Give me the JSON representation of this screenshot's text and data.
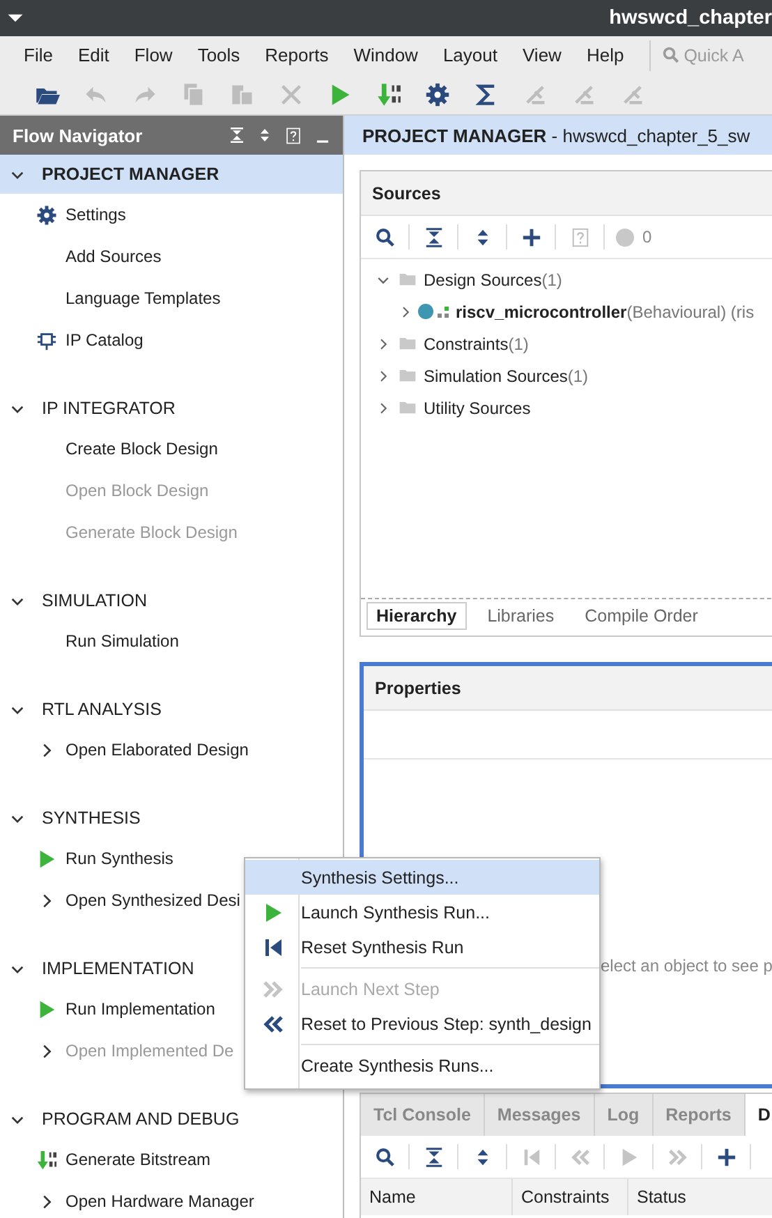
{
  "window": {
    "title": "hwswcd_chapter"
  },
  "menu": [
    "File",
    "Edit",
    "Flow",
    "Tools",
    "Reports",
    "Window",
    "Layout",
    "View",
    "Help"
  ],
  "search": {
    "placeholder": "Quick A"
  },
  "toolbar": [
    {
      "kind": "open",
      "disabled": false
    },
    {
      "kind": "undo",
      "disabled": true
    },
    {
      "kind": "redo",
      "disabled": true
    },
    {
      "kind": "copy",
      "disabled": true
    },
    {
      "kind": "paste",
      "disabled": true
    },
    {
      "kind": "delete",
      "disabled": true
    },
    {
      "kind": "run",
      "disabled": false
    },
    {
      "kind": "bitstream",
      "disabled": false
    },
    {
      "kind": "settings",
      "disabled": false
    },
    {
      "kind": "sum",
      "disabled": false
    },
    {
      "kind": "probe",
      "disabled": true
    },
    {
      "kind": "probe",
      "disabled": true
    },
    {
      "kind": "probe",
      "disabled": true
    }
  ],
  "flow_navigator": {
    "title": "Flow Navigator",
    "sections": [
      {
        "title": "PROJECT MANAGER",
        "expanded": true,
        "selected": true,
        "items": [
          {
            "label": "Settings",
            "kind": "settings",
            "disabled": false
          },
          {
            "label": "Add Sources",
            "kind": "plain",
            "disabled": false
          },
          {
            "label": "Language Templates",
            "kind": "plain",
            "disabled": false
          },
          {
            "label": "IP Catalog",
            "kind": "ip",
            "disabled": false
          }
        ]
      },
      {
        "title": "IP INTEGRATOR",
        "expanded": true,
        "selected": false,
        "items": [
          {
            "label": "Create Block Design",
            "kind": "plain",
            "disabled": false
          },
          {
            "label": "Open Block Design",
            "kind": "plain",
            "disabled": true
          },
          {
            "label": "Generate Block Design",
            "kind": "plain",
            "disabled": true
          }
        ]
      },
      {
        "title": "SIMULATION",
        "expanded": true,
        "selected": false,
        "items": [
          {
            "label": "Run Simulation",
            "kind": "plain",
            "disabled": false
          }
        ]
      },
      {
        "title": "RTL ANALYSIS",
        "expanded": true,
        "selected": false,
        "items": [
          {
            "label": "Open Elaborated Design",
            "kind": "expandable",
            "disabled": false
          }
        ]
      },
      {
        "title": "SYNTHESIS",
        "expanded": true,
        "selected": false,
        "items": [
          {
            "label": "Run Synthesis",
            "kind": "run",
            "disabled": false
          },
          {
            "label": "Open Synthesized Desi",
            "kind": "expandable",
            "disabled": false
          }
        ]
      },
      {
        "title": "IMPLEMENTATION",
        "expanded": true,
        "selected": false,
        "items": [
          {
            "label": "Run Implementation",
            "kind": "run",
            "disabled": false
          },
          {
            "label": "Open Implemented De",
            "kind": "expandable",
            "disabled": true
          }
        ]
      },
      {
        "title": "PROGRAM AND DEBUG",
        "expanded": true,
        "selected": false,
        "items": [
          {
            "label": "Generate Bitstream",
            "kind": "bitstream",
            "disabled": false
          },
          {
            "label": "Open Hardware Manager",
            "kind": "expandable",
            "disabled": false
          }
        ]
      }
    ]
  },
  "header": {
    "title": "**PROJECT MANAGER** - hwswcd_chapter_5_sw"
  },
  "sources": {
    "title": "Sources",
    "warning_count": "0",
    "toolbar": [
      {
        "kind": "search",
        "disabled": false
      },
      {
        "kind": "collapse",
        "disabled": false
      },
      {
        "kind": "expand",
        "disabled": false
      },
      {
        "kind": "add",
        "disabled": false
      },
      {
        "kind": "help",
        "disabled": true
      }
    ],
    "tree": [
      {
        "label": "Design Sources",
        "count": "(1)",
        "expanded": true,
        "children": [
          {
            "label": "riscv_microcontroller",
            "detail": "(Behavioural) (ris",
            "expanded": false
          }
        ]
      },
      {
        "label": "Constraints",
        "count": "(1)",
        "expanded": false
      },
      {
        "label": "Simulation Sources",
        "count": "(1)",
        "expanded": false
      },
      {
        "label": "Utility Sources",
        "expanded": false
      }
    ],
    "tabs": [
      {
        "label": "Hierarchy",
        "selected": true
      },
      {
        "label": "Libraries",
        "selected": false
      },
      {
        "label": "Compile Order",
        "selected": false
      }
    ]
  },
  "properties": {
    "title": "Properties",
    "message": "elect an object to see p"
  },
  "bottom_panel": {
    "tabs": [
      {
        "label": "Tcl Console",
        "selected": false
      },
      {
        "label": "Messages",
        "selected": false
      },
      {
        "label": "Log",
        "selected": false
      },
      {
        "label": "Reports",
        "selected": false
      },
      {
        "label": "D",
        "selected": true
      }
    ],
    "toolbar": [
      {
        "kind": "search",
        "disabled": false
      },
      {
        "kind": "collapse",
        "disabled": false
      },
      {
        "kind": "expand",
        "disabled": false
      },
      {
        "kind": "first",
        "disabled": true
      },
      {
        "kind": "prev",
        "disabled": true
      },
      {
        "kind": "run",
        "disabled": true
      },
      {
        "kind": "next",
        "disabled": true
      },
      {
        "kind": "add",
        "disabled": false
      }
    ],
    "columns": [
      "Name",
      "Constraints",
      "Status"
    ]
  },
  "context_menu": [
    {
      "label": "Synthesis Settings...",
      "kind": "plain",
      "selected": true,
      "disabled": false,
      "separator_before": false
    },
    {
      "label": "Launch Synthesis Run...",
      "kind": "run",
      "selected": false,
      "disabled": false,
      "separator_before": false
    },
    {
      "label": "Reset Synthesis Run",
      "kind": "first",
      "selected": false,
      "disabled": false,
      "separator_before": false
    },
    {
      "label": "Launch Next Step",
      "kind": "next",
      "selected": false,
      "disabled": true,
      "separator_before": true
    },
    {
      "label": "Reset to Previous Step: synth_design",
      "kind": "prev",
      "selected": false,
      "disabled": false,
      "separator_before": false
    },
    {
      "label": "Create Synthesis Runs...",
      "kind": "plain",
      "selected": false,
      "disabled": false,
      "separator_before": true
    }
  ]
}
